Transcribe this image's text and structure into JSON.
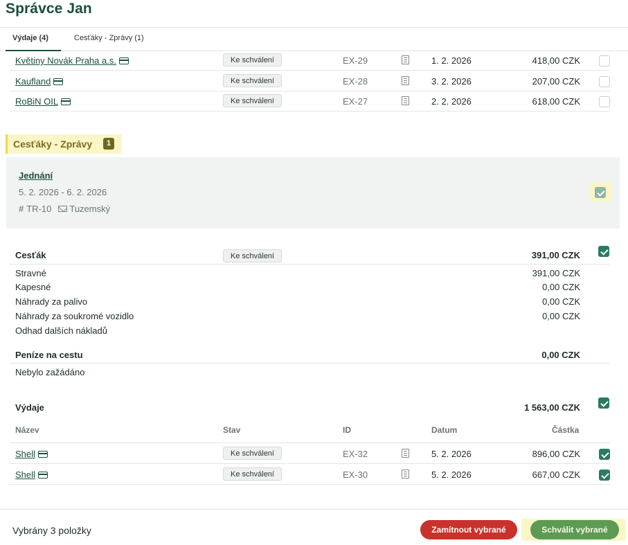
{
  "header": {
    "title": "Správce Jan"
  },
  "tabs": [
    {
      "label": "Výdaje (4)",
      "active": true
    },
    {
      "label": "Cesťáky - Zprávy (1)",
      "active": false
    }
  ],
  "expenses_top": [
    {
      "name": "Květiny Novák Praha a.s.",
      "status": "Ke schválení",
      "id": "EX-29",
      "date": "1. 2. 2026",
      "amount": "418,00 CZK",
      "checked": false
    },
    {
      "name": "Kaufland",
      "status": "Ke schválení",
      "id": "EX-28",
      "date": "3. 2. 2026",
      "amount": "207,00 CZK",
      "checked": false
    },
    {
      "name": "RoBiN OIL",
      "status": "Ke schválení",
      "id": "EX-27",
      "date": "2. 2. 2026",
      "amount": "618,00 CZK",
      "checked": false
    }
  ],
  "travel_section": {
    "label": "Cesťáky - Zprávy",
    "count": "1"
  },
  "trip": {
    "title": "Jednání",
    "dates": "5. 2. 2026 - 6. 2. 2026",
    "number": "TR-10",
    "type": "Tuzemský"
  },
  "travel_order": {
    "label": "Cesťák",
    "status": "Ke schválení",
    "total": "391,00 CZK",
    "items": [
      {
        "label": "Stravné",
        "amount": "391,00 CZK"
      },
      {
        "label": "Kapesné",
        "amount": "0,00 CZK"
      },
      {
        "label": "Náhrady za palivo",
        "amount": "0,00 CZK"
      },
      {
        "label": "Náhrady za soukromé vozidlo",
        "amount": "0,00 CZK"
      },
      {
        "label": "Odhad dalších nákladů",
        "amount": ""
      }
    ]
  },
  "advance": {
    "label": "Peníze na cestu",
    "total": "0,00 CZK",
    "note": "Nebylo zažádáno"
  },
  "trip_expenses": {
    "label": "Výdaje",
    "total": "1 563,00 CZK",
    "columns": {
      "name": "Název",
      "status": "Stav",
      "id": "ID",
      "date": "Datum",
      "amount": "Částka"
    },
    "rows": [
      {
        "name": "Shell",
        "status": "Ke schválení",
        "id": "EX-32",
        "date": "5. 2. 2026",
        "amount": "896,00 CZK",
        "checked": true
      },
      {
        "name": "Shell",
        "status": "Ke schválení",
        "id": "EX-30",
        "date": "5. 2. 2026",
        "amount": "667,00 CZK",
        "checked": true
      }
    ]
  },
  "footer": {
    "selected_text": "Vybrány 3 položky",
    "reject_label": "Zamítnout vybrané",
    "approve_label": "Schválit vybrané"
  },
  "colors": {
    "brand": "#1b4d3e",
    "check": "#2a7b63",
    "highlight": "#fbf6c8",
    "reject": "#c8322b",
    "approve": "#5d9a53"
  }
}
